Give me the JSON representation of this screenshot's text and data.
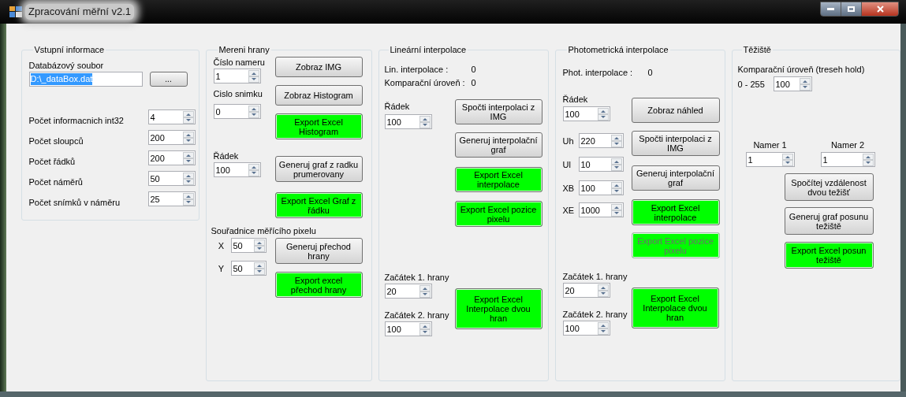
{
  "window": {
    "title": "Zpracování měřní v2.1"
  },
  "input_info": {
    "title": "Vstupní informace",
    "file_label": "Databázový soubor",
    "file_field": {
      "value": "D:\\_dataBox.dat",
      "selected": true
    },
    "browse_button": {
      "label": "..."
    },
    "params": [
      {
        "label": "Počet informacnich int32",
        "value": "4"
      },
      {
        "label": "Počet sloupců",
        "value": "200"
      },
      {
        "label": "Počet řádků",
        "value": "200"
      },
      {
        "label": "Počet náměrů",
        "value": "50"
      },
      {
        "label": "Počet snímků v náměru",
        "value": "25"
      }
    ]
  },
  "edge_measurement": {
    "title": "Mereni hrany",
    "measurement": {
      "label": "Číslo nameru",
      "value": "1"
    },
    "frame": {
      "label": "Cislo snimku",
      "value": "0"
    },
    "row": {
      "label": "Řádek",
      "value": "100"
    },
    "pixel_label": "Souřadnice měřícího pixelu",
    "x": {
      "label": "X",
      "value": "50"
    },
    "y": {
      "label": "Y",
      "value": "50"
    },
    "buttons": [
      {
        "label": "Zobraz IMG",
        "kind": "standard",
        "disabled": false
      },
      {
        "label": "Zobraz Histogram",
        "kind": "standard",
        "disabled": false
      },
      {
        "label": "Export Excel Histogram",
        "kind": "export",
        "disabled": false
      },
      {
        "label": "Generuj graf z radku prumerovany",
        "kind": "standard",
        "disabled": false
      },
      {
        "label": "Export Excel Graf z řádku",
        "kind": "export",
        "disabled": false
      },
      {
        "label": "Generuj přechod hrany",
        "kind": "standard",
        "disabled": false
      },
      {
        "label": "Export excel přechod hrany",
        "kind": "export",
        "disabled": false
      }
    ]
  },
  "linear_interpolation": {
    "title": "Lineární interpolace",
    "readouts": [
      {
        "label": "Lin. interpolace :",
        "value": "0"
      },
      {
        "label": "Komparační úroveň :",
        "value": "0"
      }
    ],
    "row": {
      "label": "Řádek",
      "value": "100"
    },
    "edge1": {
      "label": "Začátek 1. hrany",
      "value": "20"
    },
    "edge2": {
      "label": "Začátek 2. hrany",
      "value": "100"
    },
    "buttons": [
      {
        "label": "Spočti interpolaci z IMG",
        "kind": "standard",
        "disabled": false
      },
      {
        "label": "Generuj interpolační graf",
        "kind": "standard",
        "disabled": false
      },
      {
        "label": "Export Excel interpolace",
        "kind": "export",
        "disabled": false
      },
      {
        "label": "Export Excel pozice pixelu",
        "kind": "export",
        "disabled": false
      },
      {
        "label": "Export Excel Interpolace dvou hran",
        "kind": "export",
        "disabled": false
      }
    ]
  },
  "photometric_interpolation": {
    "title": "Photometrická interpolace",
    "readouts": [
      {
        "label": "Phot. interpolace :",
        "value": "0"
      }
    ],
    "row": {
      "label": "Řádek",
      "value": "100"
    },
    "params": [
      {
        "label": "Uh",
        "value": "220"
      },
      {
        "label": "Ul",
        "value": "10"
      },
      {
        "label": "XB",
        "value": "100"
      },
      {
        "label": "XE",
        "value": "1000"
      }
    ],
    "edge1": {
      "label": "Začátek 1. hrany",
      "value": "20"
    },
    "edge2": {
      "label": "Začátek 2. hrany",
      "value": "100"
    },
    "buttons": [
      {
        "label": "Zobraz náhled",
        "kind": "standard",
        "disabled": false
      },
      {
        "label": "Spočti interpolaci z IMG",
        "kind": "standard",
        "disabled": false
      },
      {
        "label": "Generuj interpolační graf",
        "kind": "standard",
        "disabled": false
      },
      {
        "label": "Export Excel interpolace",
        "kind": "export",
        "disabled": false
      },
      {
        "label": "Export Excel pozice pixelu",
        "kind": "export",
        "disabled": true
      },
      {
        "label": "Export Excel Interpolace dvou hran",
        "kind": "export",
        "disabled": false
      }
    ]
  },
  "centroid": {
    "title": "Těžiště",
    "threshold_label": "Komparační úroveň (treseh hold)",
    "range_label": "0 - 255",
    "threshold_value": "100",
    "measurement1": {
      "label": "Namer 1",
      "value": "1"
    },
    "measurement2": {
      "label": "Namer 2",
      "value": "1"
    },
    "buttons": [
      {
        "label": "Spočítej vzdálenost dvou težišť",
        "kind": "standard",
        "disabled": false
      },
      {
        "label": "Generuj graf posunu težiště",
        "kind": "standard",
        "disabled": false
      },
      {
        "label": "Export Excel posun težiště",
        "kind": "export",
        "disabled": false
      }
    ]
  }
}
